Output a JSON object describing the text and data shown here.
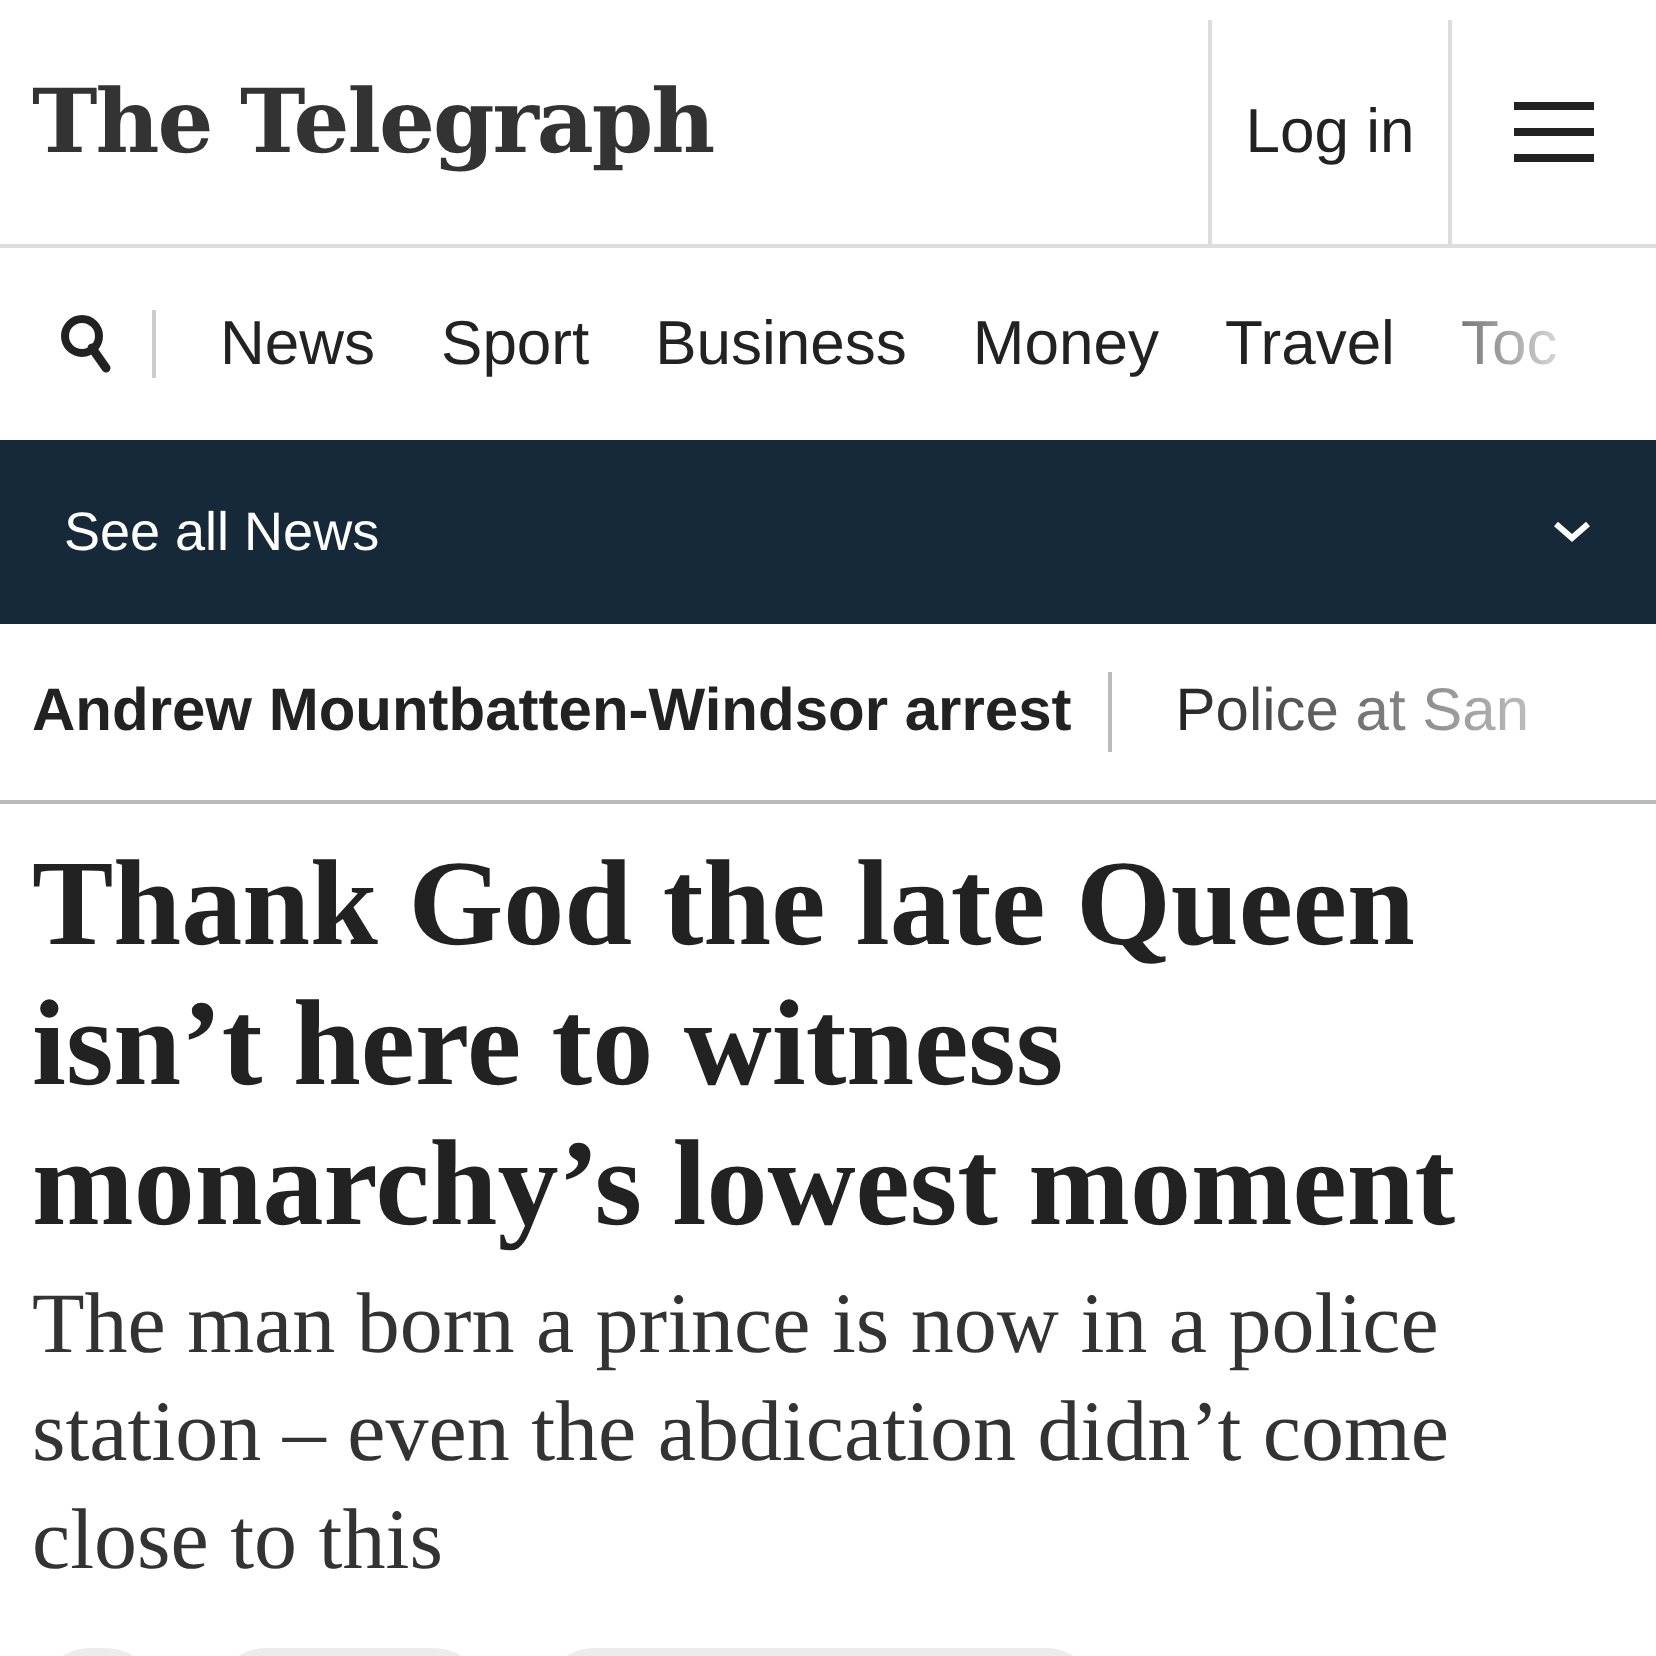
{
  "header": {
    "logo": "The Telegraph",
    "login": "Log in"
  },
  "nav": {
    "items": [
      {
        "label": "News",
        "faded": false
      },
      {
        "label": "Sport",
        "faded": false
      },
      {
        "label": "Business",
        "faded": false
      },
      {
        "label": "Money",
        "faded": false
      },
      {
        "label": "Travel",
        "faded": false
      },
      {
        "label": "Toc",
        "faded": true
      }
    ]
  },
  "section_bar": {
    "label": "See all News"
  },
  "trending": [
    {
      "label": "Andrew Mountbatten-Windsor arrest",
      "faded": false
    },
    {
      "label": "Police at San",
      "faded": true
    }
  ],
  "article": {
    "headline": "Thank God the late Queen isn’t here to witness monarchy’s lowest moment",
    "standfirst": "The man born a prince is now in a police station – even the abdication didn’t come close to this"
  }
}
